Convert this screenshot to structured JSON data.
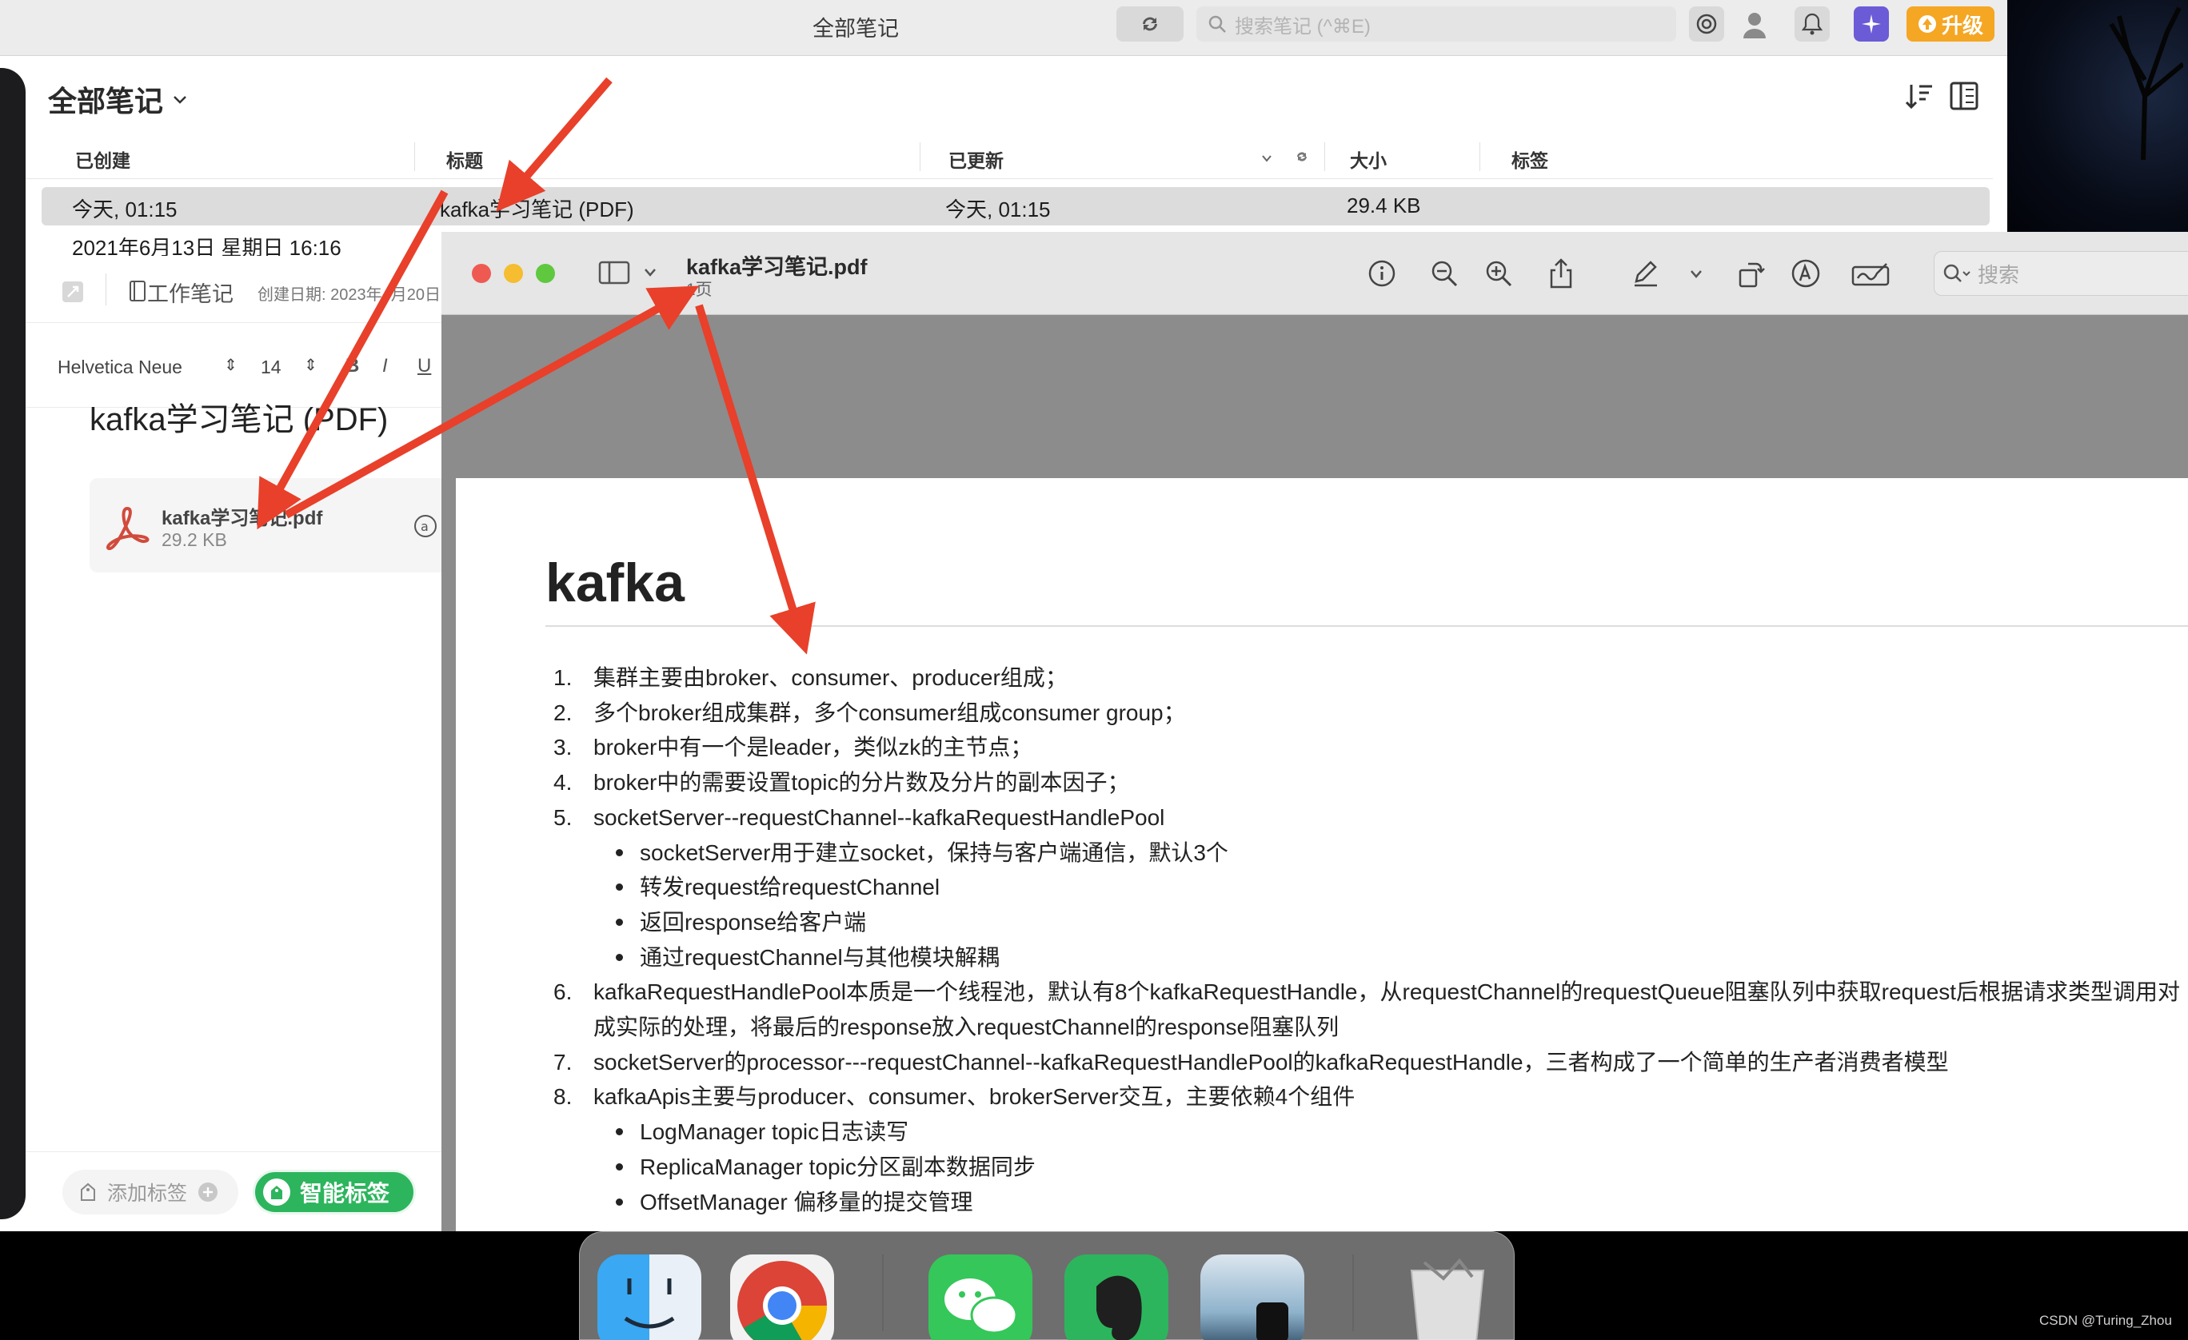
{
  "evernote": {
    "window_title": "全部笔记",
    "search_placeholder": "搜索笔记 (^⌘E)",
    "upgrade_label": "升级",
    "list_title": "全部笔记",
    "columns": {
      "created": "已创建",
      "title": "标题",
      "updated": "已更新",
      "size": "大小",
      "tags": "标签"
    },
    "rows": [
      {
        "created": "今天, 01:15",
        "title": "kafka学习笔记 (PDF)",
        "updated": "今天, 01:15",
        "size": "29.4 KB"
      },
      {
        "created": "2021年6月13日 星期日 16:16",
        "title": "",
        "updated": "",
        "size": ""
      }
    ],
    "editor": {
      "notebook": "工作笔记",
      "created_date": "创建日期: 2023年4月20日",
      "font_name": "Helvetica Neue",
      "font_size": "14",
      "bold": "B",
      "italic": "I",
      "underline": "U",
      "note_title": "kafka学习笔记 (PDF)",
      "attachment_name": "kafka学习笔记.pdf",
      "attachment_size": "29.2 KB",
      "add_tag": "添加标签",
      "smart_tag": "智能标签"
    }
  },
  "preview": {
    "file_name": "kafka学习笔记.pdf",
    "page_count": "1页",
    "search_placeholder": "搜索",
    "doc_heading": "kafka",
    "items": [
      {
        "n": "1.",
        "text": "集群主要由broker、consumer、producer组成；"
      },
      {
        "n": "2.",
        "text": "多个broker组成集群，多个consumer组成consumer group；"
      },
      {
        "n": "3.",
        "text": "broker中有一个是leader，类似zk的主节点；"
      },
      {
        "n": "4.",
        "text": "broker中的需要设置topic的分片数及分片的副本因子；"
      },
      {
        "n": "5.",
        "text": "socketServer--requestChannel--kafkaRequestHandlePool"
      },
      {
        "sub": "socketServer用于建立socket，保持与客户端通信，默认3个"
      },
      {
        "sub": "转发request给requestChannel"
      },
      {
        "sub": "返回response给客户端"
      },
      {
        "sub": "通过requestChannel与其他模块解耦"
      },
      {
        "n": "6.",
        "text": "kafkaRequestHandlePool本质是一个线程池，默认有8个kafkaRequestHandle，从requestChannel的requestQueue阻塞队列中获取request后根据请求类型调用对"
      },
      {
        "cont": "成实际的处理，将最后的response放入requestChannel的response阻塞队列"
      },
      {
        "n": "7.",
        "text": "socketServer的processor---requestChannel--kafkaRequestHandlePool的kafkaRequestHandle，三者构成了一个简单的生产者消费者模型"
      },
      {
        "n": "8.",
        "text": "kafkaApis主要与producer、consumer、brokerServer交互，主要依赖4个组件"
      },
      {
        "sub": "LogManager topic日志读写"
      },
      {
        "sub": "ReplicaManager topic分区副本数据同步"
      },
      {
        "sub": "OffsetManager 偏移量的提交管理"
      }
    ]
  },
  "watermark": "CSDN @Turing_Zhou",
  "colors": {
    "arrow": "#e8402a",
    "upgrade": "#f5a623",
    "smart_tag": "#2db55d"
  }
}
